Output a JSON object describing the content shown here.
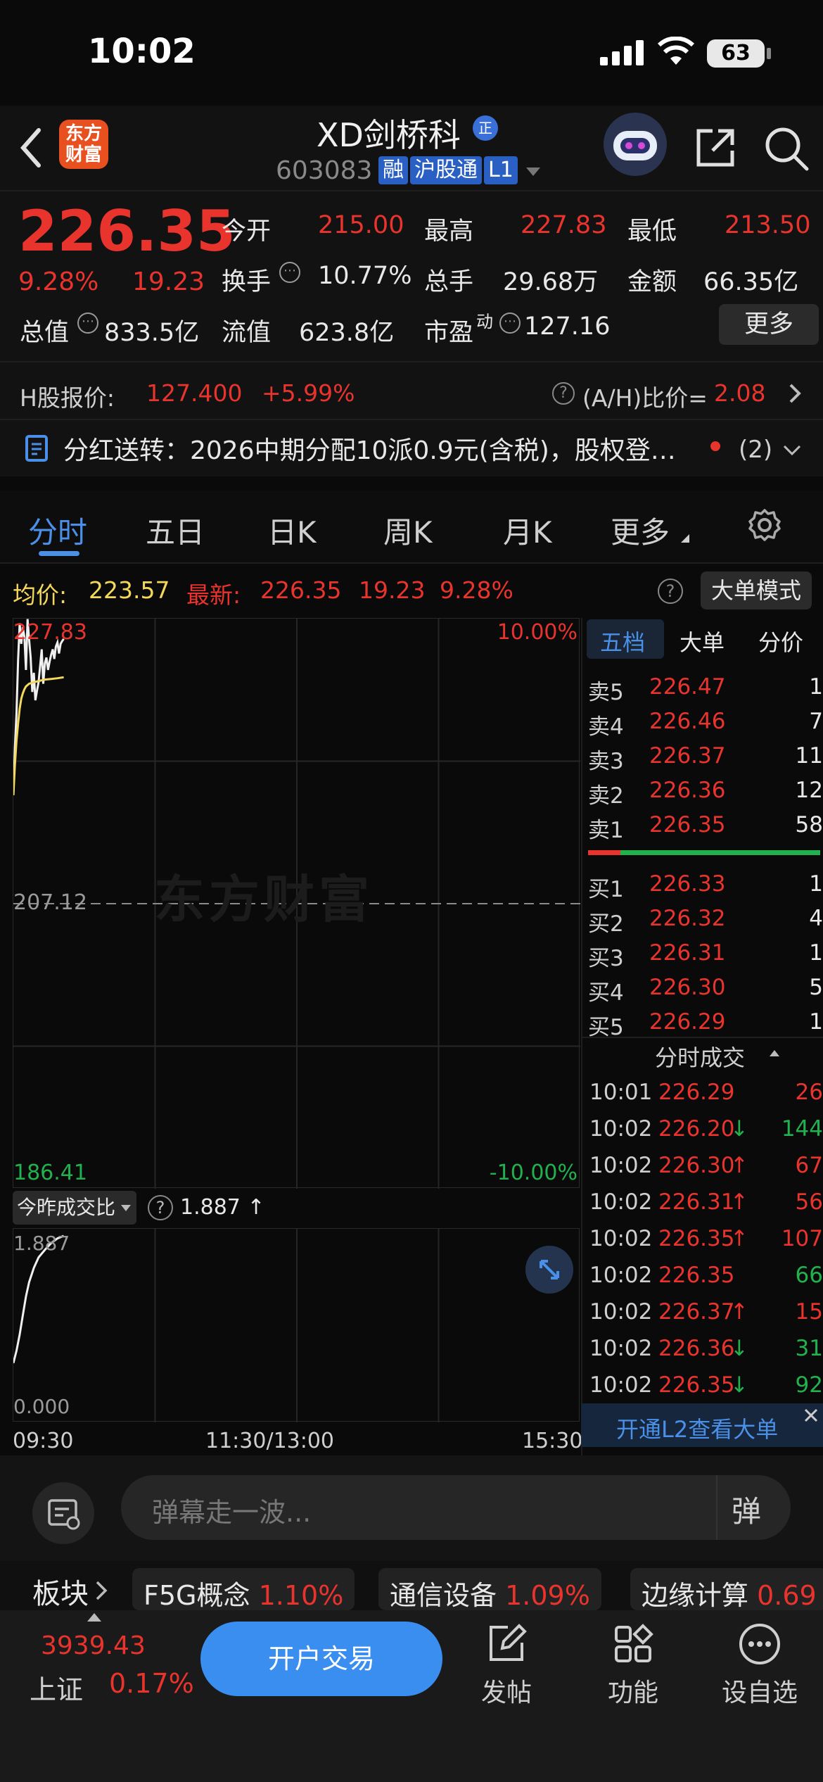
{
  "status_bar": {
    "time": "10:02",
    "battery": "63"
  },
  "header": {
    "stock_name": "XD剑桥科",
    "code": "603083",
    "tag_margin": "融",
    "tag_connect": "沪股通",
    "tag_level": "L1",
    "logo_text": "东方财富",
    "verified": "正"
  },
  "quote": {
    "price": "226.35",
    "change_pct": "9.28%",
    "change": "19.23",
    "open_label": "今开",
    "open": "215.00",
    "high_label": "最高",
    "high": "227.83",
    "low_label": "最低",
    "low": "213.50",
    "turnover_label": "换手",
    "turnover": "10.77%",
    "volume_label": "总手",
    "volume": "29.68万",
    "amount_label": "金额",
    "amount": "66.35亿",
    "mcap_label": "总值",
    "mcap": "833.5亿",
    "float_label": "流值",
    "float_mcap": "623.8亿",
    "pe_label": "市盈",
    "pe_sup": "动",
    "pe": "127.16",
    "more_button": "更多"
  },
  "h_share": {
    "label": "H股报价:",
    "price": "127.400",
    "change": "+5.99%",
    "ratio_label": "(A/H)比价=",
    "ratio": "2.08"
  },
  "notice": {
    "text": "分红送转：2026中期分配10派0.9元(含税)，股权登…",
    "count": "(2)"
  },
  "tabs": [
    {
      "label": "分时",
      "active": true
    },
    {
      "label": "五日"
    },
    {
      "label": "日K"
    },
    {
      "label": "周K"
    },
    {
      "label": "月K"
    },
    {
      "label": "更多"
    }
  ],
  "chart_legend": {
    "avg_label": "均价:",
    "avg": "223.57",
    "latest_label": "最新:",
    "latest": "226.35",
    "change": "19.23",
    "change_pct": "9.28%",
    "big_order_button": "大单模式"
  },
  "chart": {
    "max_price": "227.83",
    "mid_price": "207.12",
    "min_price": "186.41",
    "max_pct": "10.00%",
    "min_pct": "-10.00%",
    "watermark": "东方财富",
    "time_start": "09:30",
    "time_mid": "11:30/13:00",
    "time_end": "15:30"
  },
  "volume_panel": {
    "selector": "今昨成交比",
    "value": "1.887 ↑",
    "top": "1.887",
    "bottom": "0.000"
  },
  "chart_data": {
    "type": "line",
    "title": "",
    "xlabel": "",
    "ylabel": "",
    "ylim": [
      186.41,
      227.83
    ],
    "x_range": [
      "09:30",
      "15:30"
    ],
    "series": [
      {
        "name": "最新",
        "x": [
          "09:30",
          "09:31",
          "09:32",
          "09:33",
          "09:34",
          "09:35",
          "09:36",
          "09:37",
          "09:38",
          "09:39",
          "09:40",
          "09:41",
          "09:42",
          "09:43",
          "09:44",
          "09:45",
          "09:46",
          "09:47",
          "09:48",
          "09:49",
          "09:50",
          "09:51",
          "09:52",
          "09:53",
          "09:54",
          "09:55",
          "09:56",
          "09:57",
          "09:58",
          "09:59",
          "10:00",
          "10:01",
          "10:02"
        ],
        "values": [
          215.0,
          218.5,
          221.0,
          224.8,
          227.5,
          226.0,
          227.2,
          226.5,
          224.1,
          227.8,
          226.3,
          225.0,
          222.5,
          223.9,
          221.9,
          222.6,
          223.2,
          224.4,
          225.6,
          223.1,
          224.6,
          225.0,
          224.1,
          224.7,
          225.2,
          225.6,
          224.9,
          225.8,
          226.1,
          225.3,
          226.0,
          226.2,
          226.35
        ]
      },
      {
        "name": "均价",
        "x": [
          "09:30",
          "09:31",
          "09:32",
          "09:33",
          "09:34",
          "09:35",
          "09:36",
          "09:37",
          "09:38",
          "09:40",
          "09:43",
          "09:46",
          "09:50",
          "09:54",
          "09:58",
          "10:02"
        ],
        "values": [
          215.0,
          217.2,
          219.0,
          220.2,
          221.3,
          222.0,
          222.4,
          222.7,
          222.9,
          223.1,
          223.2,
          223.3,
          223.4,
          223.45,
          223.5,
          223.57
        ]
      }
    ]
  },
  "vol_ratio_data": {
    "x": [
      "09:30",
      "09:32",
      "09:34",
      "09:36",
      "09:38",
      "09:40",
      "09:43",
      "09:46",
      "09:50",
      "09:54",
      "09:58",
      "10:02"
    ],
    "values": [
      0.55,
      0.68,
      0.85,
      1.05,
      1.25,
      1.4,
      1.55,
      1.66,
      1.74,
      1.81,
      1.86,
      1.887
    ],
    "ylim": [
      0.0,
      1.887
    ]
  },
  "order_book": {
    "tabs": [
      "五档",
      "大单",
      "分价"
    ],
    "asks": [
      {
        "label": "卖5",
        "price": "226.47",
        "qty": "1"
      },
      {
        "label": "卖4",
        "price": "226.46",
        "qty": "7"
      },
      {
        "label": "卖3",
        "price": "226.37",
        "qty": "11"
      },
      {
        "label": "卖2",
        "price": "226.36",
        "qty": "12"
      },
      {
        "label": "卖1",
        "price": "226.35",
        "qty": "58"
      }
    ],
    "bids": [
      {
        "label": "买1",
        "price": "226.33",
        "qty": "1"
      },
      {
        "label": "买2",
        "price": "226.32",
        "qty": "4"
      },
      {
        "label": "买3",
        "price": "226.31",
        "qty": "1"
      },
      {
        "label": "买4",
        "price": "226.30",
        "qty": "5"
      },
      {
        "label": "买5",
        "price": "226.29",
        "qty": "1"
      }
    ]
  },
  "ticks": {
    "title": "分时成交",
    "rows": [
      {
        "time": "10:01",
        "price": "226.29",
        "arrow": "",
        "qty": "26",
        "color": "#e8342d"
      },
      {
        "time": "10:02",
        "price": "226.20",
        "arrow": "↓",
        "qty": "144",
        "color": "#22b14c"
      },
      {
        "time": "10:02",
        "price": "226.30",
        "arrow": "↑",
        "qty": "67",
        "color": "#e8342d"
      },
      {
        "time": "10:02",
        "price": "226.31",
        "arrow": "↑",
        "qty": "56",
        "color": "#e8342d"
      },
      {
        "time": "10:02",
        "price": "226.35",
        "arrow": "↑",
        "qty": "107",
        "color": "#e8342d"
      },
      {
        "time": "10:02",
        "price": "226.35",
        "arrow": "",
        "qty": "66",
        "color": "#22b14c"
      },
      {
        "time": "10:02",
        "price": "226.37",
        "arrow": "↑",
        "qty": "15",
        "color": "#e8342d"
      },
      {
        "time": "10:02",
        "price": "226.36",
        "arrow": "↓",
        "qty": "31",
        "color": "#22b14c"
      },
      {
        "time": "10:02",
        "price": "226.35",
        "arrow": "↓",
        "qty": "92",
        "color": "#22b14c"
      }
    ],
    "l2_banner": "开通L2查看大单"
  },
  "comment_bar": {
    "placeholder": "弹幕走一波...",
    "barrage_button": "弹"
  },
  "sectors": {
    "label": "板块",
    "items": [
      {
        "name": "F5G概念",
        "pct": "1.10%"
      },
      {
        "name": "通信设备",
        "pct": "1.09%"
      },
      {
        "name": "边缘计算",
        "pct": "0.69"
      }
    ]
  },
  "bottom_nav": {
    "index_value": "3939.43",
    "index_name": "上证",
    "index_pct": "0.17%",
    "trade_button": "开户交易",
    "post": "发帖",
    "functions": "功能",
    "watchlist": "设自选"
  },
  "colors": {
    "up": "#e8342d",
    "down": "#22b14c",
    "accent": "#3a8ef0",
    "avg_line": "#f3d85c"
  }
}
